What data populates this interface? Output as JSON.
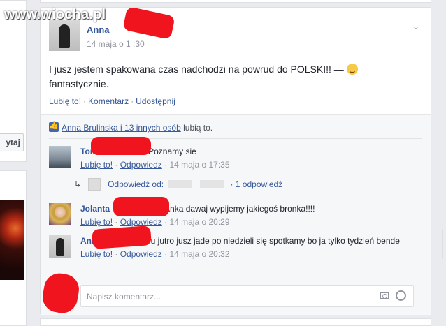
{
  "watermark": "www.wiocha.pl",
  "left": {
    "button_label": "ytaj"
  },
  "post": {
    "author": "Anna",
    "timestamp": "14 maja o 1 :30",
    "text": "I jusz jestem spakowana czas nadchodzi na powrud do POLSKI!! —",
    "feeling": "fantastycznie.",
    "actions": [
      "Lubię to!",
      "Komentarz",
      "Udostępnij"
    ]
  },
  "likes": {
    "names": "Anna Brulinska i 13 innych osób",
    "suffix": " lubią to."
  },
  "comments": [
    {
      "name": "Toma",
      "text": "Poznamy sie",
      "like": "Lubię to!",
      "reply": "Odpowiedz",
      "time": "14 maja o 17:35"
    },
    {
      "name": "Jolanta",
      "text": "Anka dawaj wypijemy jakiegoś bronka!!!!",
      "like": "Lubię to!",
      "reply": "Odpowiedz",
      "time": "14 maja o 20:29"
    },
    {
      "name": "Ann",
      "text": "olu jutro jusz jade po niedzieli się spotkamy bo ja tylko tydzień bende",
      "like": "Lubię to!",
      "reply": "Odpowiedz",
      "time": "14 maja o 20:32"
    }
  ],
  "reply_thread": {
    "prefix": "Odpowiedź od:",
    "count": "1 odpowiedź"
  },
  "composer": {
    "placeholder": "Napisz komentarz..."
  },
  "icons": [
    "chevron-down-icon",
    "like-thumb-icon",
    "reply-arrow-icon",
    "camera-icon",
    "emoji-icon"
  ],
  "colors": {
    "link": "#365899",
    "meta": "#90949c",
    "redaction": "#f0141e"
  }
}
